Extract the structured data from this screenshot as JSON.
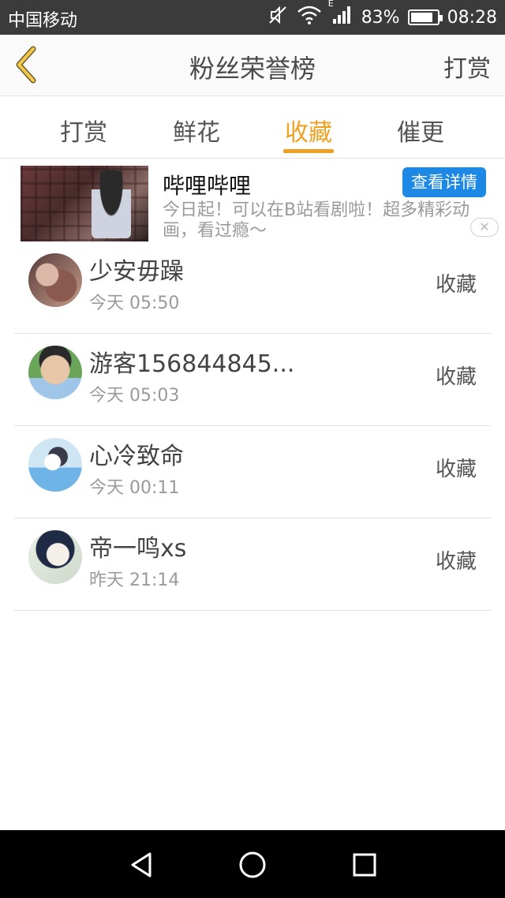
{
  "status_bar": {
    "carrier": "中国移动",
    "network_type": "E",
    "battery_percent": "83%",
    "battery_level": 0.83,
    "time": "08:28",
    "icons": [
      "mute-icon",
      "wifi-icon",
      "signal-icon",
      "battery-icon"
    ]
  },
  "header": {
    "title": "粉丝荣誉榜",
    "right_action": "打赏",
    "back_icon": "chevron-left-icon"
  },
  "tabs": [
    {
      "label": "打赏",
      "active": false
    },
    {
      "label": "鲜花",
      "active": false
    },
    {
      "label": "收藏",
      "active": true
    },
    {
      "label": "催更",
      "active": false
    }
  ],
  "ad": {
    "title": "哔哩哔哩",
    "description": "今日起！可以在B站看剧啦！超多精彩动画，看过瘾～",
    "button_label": "查看详情",
    "close_label": "✕"
  },
  "list": [
    {
      "name": "少安毋躁",
      "time": "今天 05:50",
      "action": "收藏"
    },
    {
      "name": "游客156844845...",
      "time": "今天 05:03",
      "action": "收藏"
    },
    {
      "name": "心冷致命",
      "time": "今天 00:11",
      "action": "收藏"
    },
    {
      "name": "帝一鸣xs",
      "time": "昨天 21:14",
      "action": "收藏"
    }
  ],
  "nav_bar": {
    "icons": [
      "back-triangle-icon",
      "home-circle-icon",
      "recents-square-icon"
    ]
  },
  "colors": {
    "accent": "#f0a020",
    "ad_button": "#1e88e5",
    "status_bar": "#3b3b3b"
  }
}
